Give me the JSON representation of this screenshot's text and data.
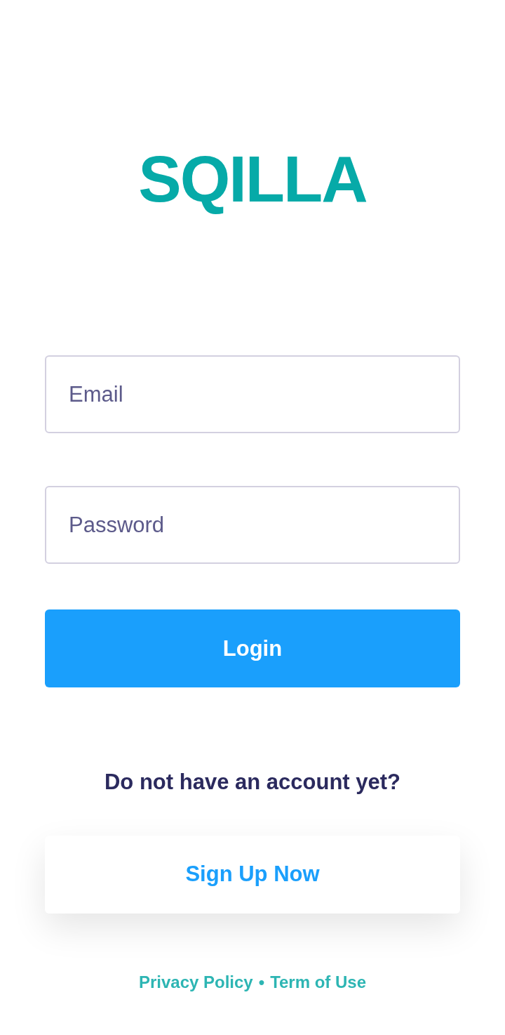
{
  "logo": {
    "text": "SQILLA"
  },
  "fields": [
    {
      "placeholder": "Email"
    },
    {
      "placeholder": "Password"
    }
  ],
  "login_button": {
    "label": "Login"
  },
  "signup_prompt": "Do not have an account yet?",
  "signup_button": {
    "label": "Sign Up Now"
  },
  "footer": {
    "links": [
      "Privacy Policy",
      "Term of Use"
    ],
    "separator": "•"
  }
}
